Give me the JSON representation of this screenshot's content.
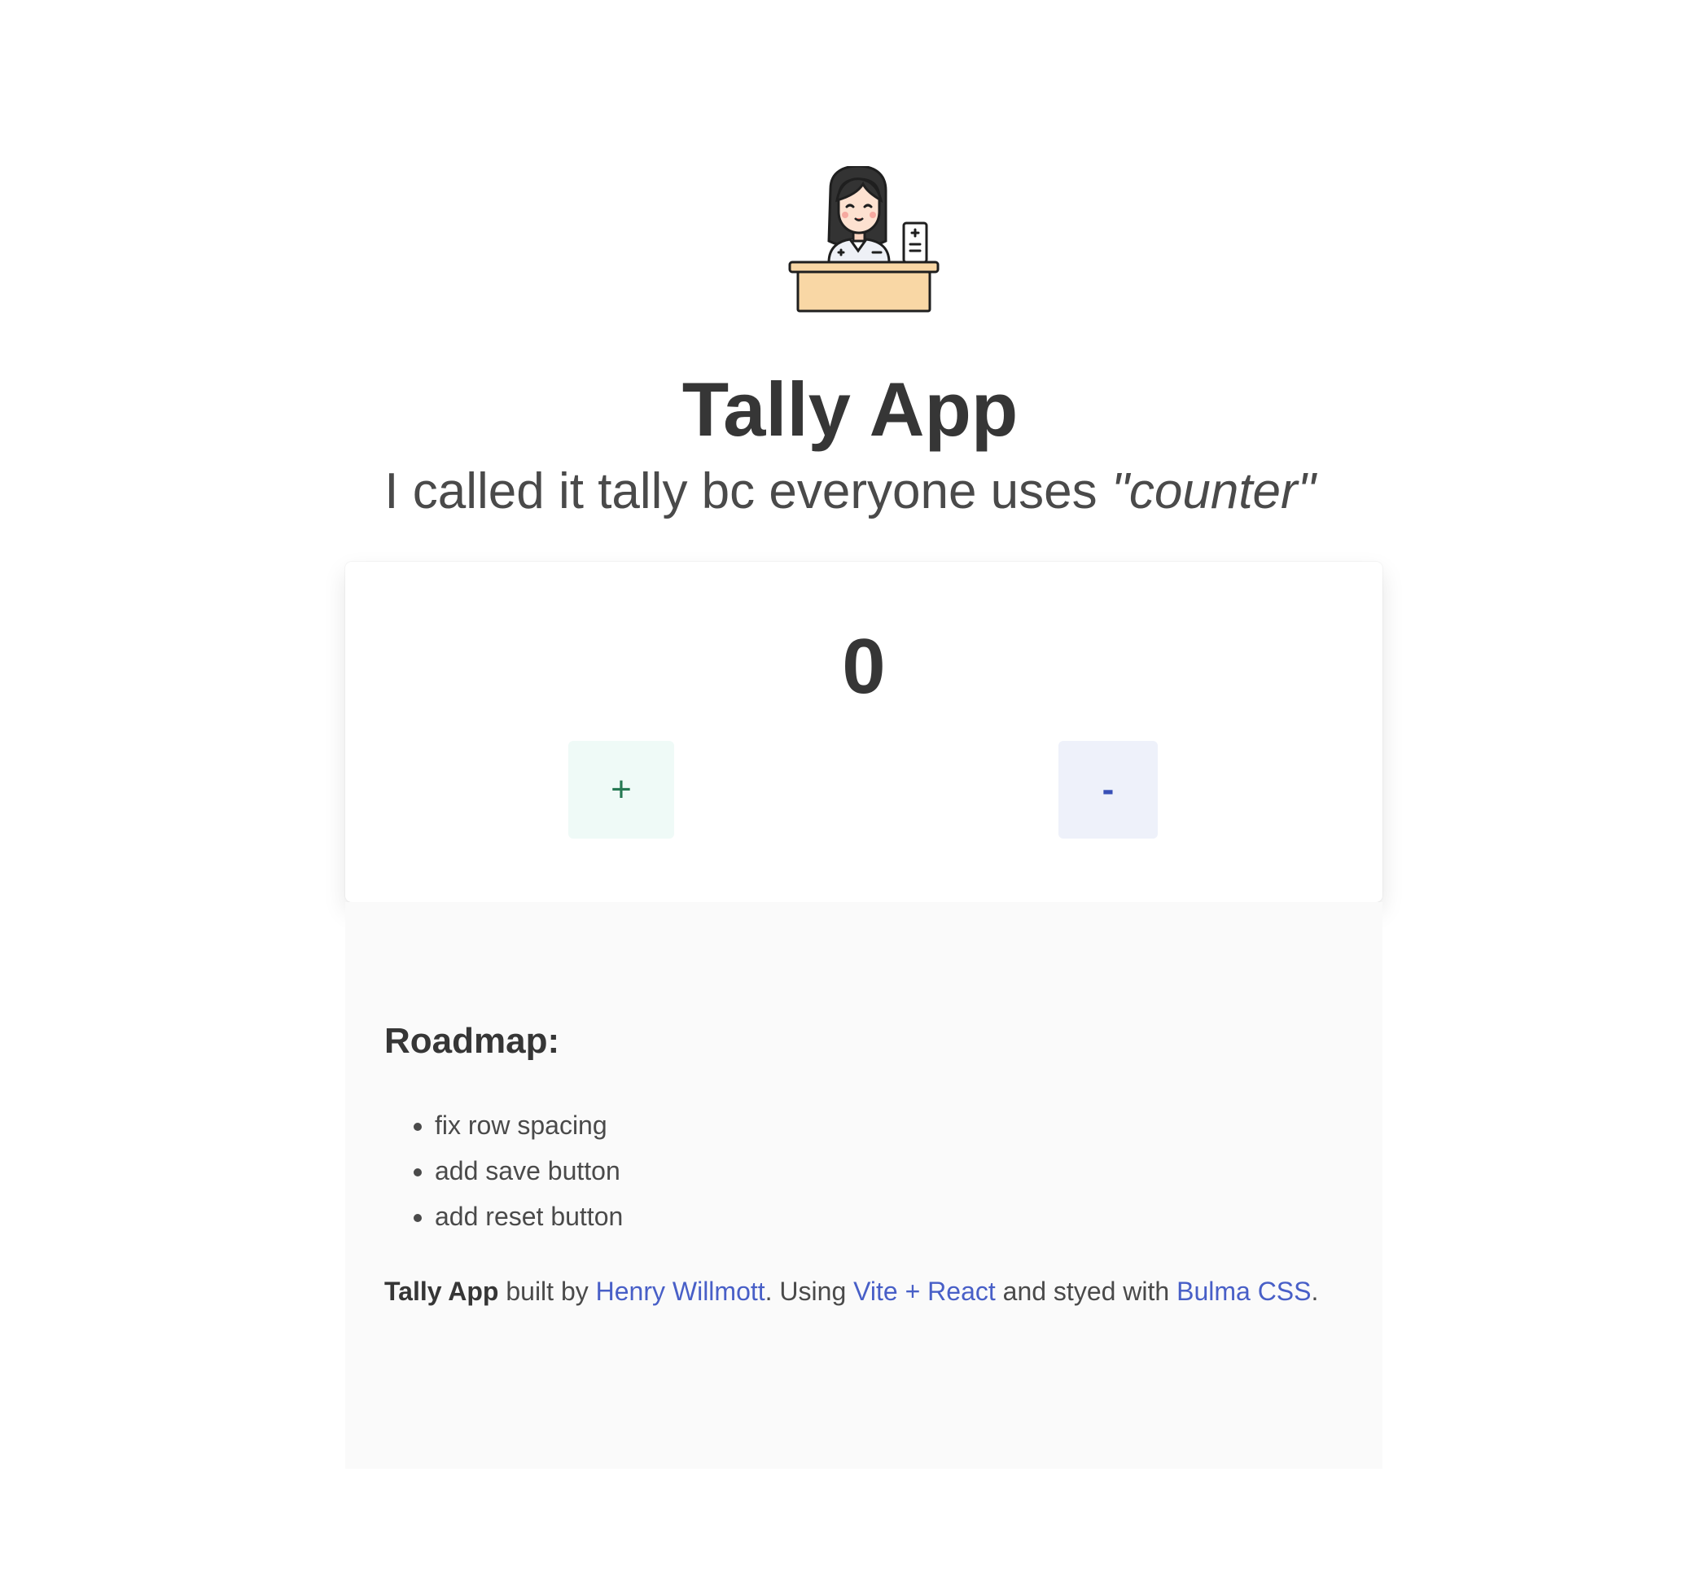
{
  "header": {
    "mascot_icon": "receptionist-at-desk-icon",
    "title": "Tally App",
    "subtitle_prefix": "I called it tally bc everyone uses ",
    "subtitle_emphasis": "\"counter\""
  },
  "counter": {
    "value": "0",
    "increment_label": "+",
    "decrement_label": "-"
  },
  "roadmap": {
    "heading": "Roadmap:",
    "items": [
      "fix row spacing",
      "add save button",
      "add reset button"
    ]
  },
  "credits": {
    "app_name": "Tally App",
    "text_built_by": " built by ",
    "author_link": "Henry Willmott",
    "text_using": ". Using ",
    "tech_link": "Vite + React",
    "text_styled": " and styed with ",
    "css_link": "Bulma CSS",
    "text_end": "."
  },
  "colors": {
    "link": "#485fc7",
    "plus_button_bg": "#effaf7",
    "plus_button_text": "#257953",
    "minus_button_bg": "#eef1fa",
    "minus_button_text": "#3850b7",
    "footer_bg": "#fafafa",
    "desk": "#f9d7a5"
  }
}
